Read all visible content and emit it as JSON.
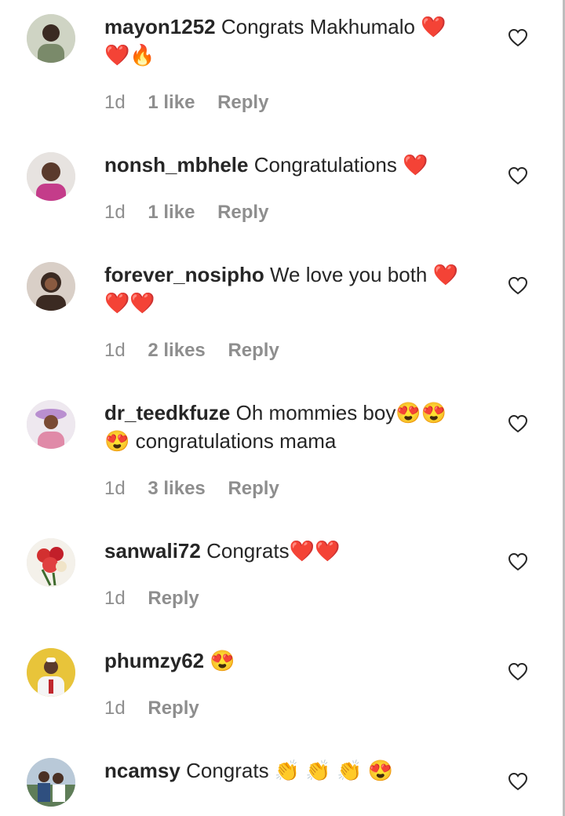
{
  "comments": [
    {
      "username": "mayon1252",
      "body": "Congrats Makhumalo ",
      "emoji": "❤️",
      "body2": "",
      "emoji2": "❤️🔥",
      "time": "1d",
      "likes": "1 like",
      "reply": "Reply",
      "avatar_color": "#7a8a6a"
    },
    {
      "username": "nonsh_mbhele",
      "body": "Congratulations ",
      "emoji": "❤️",
      "body2": "",
      "emoji2": "",
      "time": "1d",
      "likes": "1 like",
      "reply": "Reply",
      "avatar_color": "#c43c8a"
    },
    {
      "username": "forever_nosipho",
      "body": "We love you both ",
      "emoji": "❤️",
      "body2": "",
      "emoji2": "❤️❤️",
      "time": "1d",
      "likes": "2 likes",
      "reply": "Reply",
      "avatar_color": "#3b2a22"
    },
    {
      "username": "dr_teedkfuze",
      "body": "Oh mommies boy",
      "emoji": "😍😍",
      "body2": " congratulations mama",
      "emoji2": "😍",
      "time": "1d",
      "likes": "3 likes",
      "reply": "Reply",
      "avatar_color": "#b98fd0"
    },
    {
      "username": "sanwali72",
      "body": "Congrats",
      "emoji": "❤️❤️",
      "body2": "",
      "emoji2": "",
      "time": "1d",
      "likes": "",
      "reply": "Reply",
      "avatar_color": "#d23030"
    },
    {
      "username": "phumzy62",
      "body": " ",
      "emoji": "😍",
      "body2": "",
      "emoji2": "",
      "time": "1d",
      "likes": "",
      "reply": "Reply",
      "avatar_color": "#e8c43a"
    },
    {
      "username": "ncamsy",
      "body": "Congrats ",
      "emoji": "👏 👏 👏 😍",
      "body2": "",
      "emoji2": "",
      "time": "",
      "likes": "",
      "reply": "",
      "avatar_color": "#5f7d58"
    }
  ],
  "icons": {
    "like": "heart-outline-icon"
  }
}
